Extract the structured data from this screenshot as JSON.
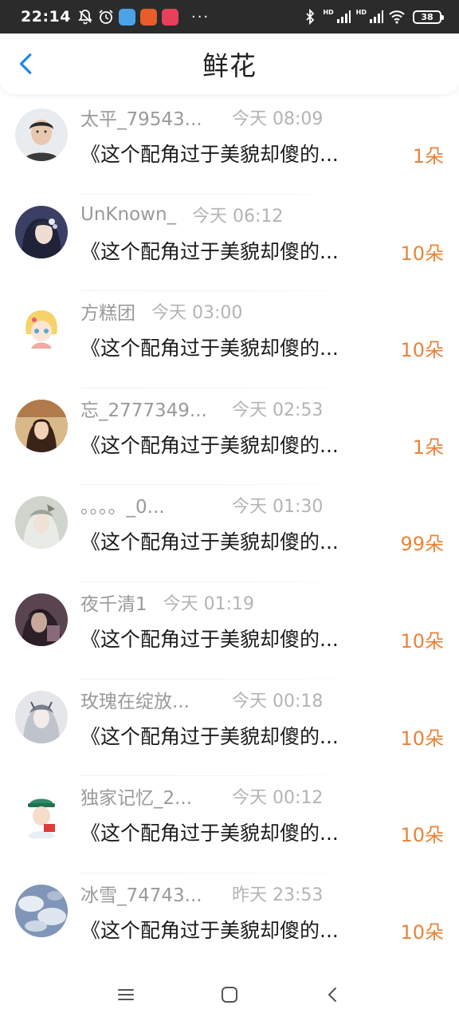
{
  "status_bar": {
    "time": "22:14",
    "icons": [
      "mute-bell-icon",
      "alarm-icon",
      "app-icon-blue",
      "app-icon-orange",
      "app-icon-red"
    ],
    "more": "···",
    "right_icons": [
      "bluetooth-icon",
      "signal-icon",
      "signal-icon",
      "wifi-icon"
    ],
    "signal_label": "HD",
    "battery": "38"
  },
  "header": {
    "title": "鲜花",
    "back_icon": "chevron-left-icon",
    "accent_color": "#1e88e5"
  },
  "accent_count_color": "#e8843a",
  "items": [
    {
      "username": "太平_79543...",
      "time": "今天 08:09",
      "book": "《这个配角过于美貌却傻的...",
      "count": "1朵",
      "avatar": "avatar-1"
    },
    {
      "username": "UnKnown_",
      "time": "今天 06:12",
      "book": "《这个配角过于美貌却傻的...",
      "count": "10朵",
      "avatar": "avatar-2"
    },
    {
      "username": "方糕团",
      "time": "今天 03:00",
      "book": "《这个配角过于美貌却傻的...",
      "count": "10朵",
      "avatar": "avatar-3"
    },
    {
      "username": "忘_2777349...",
      "time": "今天 02:53",
      "book": "《这个配角过于美貌却傻的...",
      "count": "1朵",
      "avatar": "avatar-4"
    },
    {
      "username": "。。。。_0...",
      "time": "今天 01:30",
      "book": "《这个配角过于美貌却傻的...",
      "count": "99朵",
      "avatar": "avatar-5"
    },
    {
      "username": "夜千清1",
      "time": "今天 01:19",
      "book": "《这个配角过于美貌却傻的...",
      "count": "10朵",
      "avatar": "avatar-6"
    },
    {
      "username": "玫瑰在绽放...",
      "time": "今天 00:18",
      "book": "《这个配角过于美貌却傻的...",
      "count": "10朵",
      "avatar": "avatar-7"
    },
    {
      "username": "独家记忆_2...",
      "time": "今天 00:12",
      "book": "《这个配角过于美貌却傻的...",
      "count": "10朵",
      "avatar": "avatar-8"
    },
    {
      "username": "冰雪_74743...",
      "time": "昨天 23:53",
      "book": "《这个配角过于美貌却傻的...",
      "count": "10朵",
      "avatar": "avatar-9"
    }
  ],
  "nav": {
    "menu_icon": "menu-icon",
    "home_icon": "home-square-icon",
    "back_icon": "back-chevron-icon"
  }
}
